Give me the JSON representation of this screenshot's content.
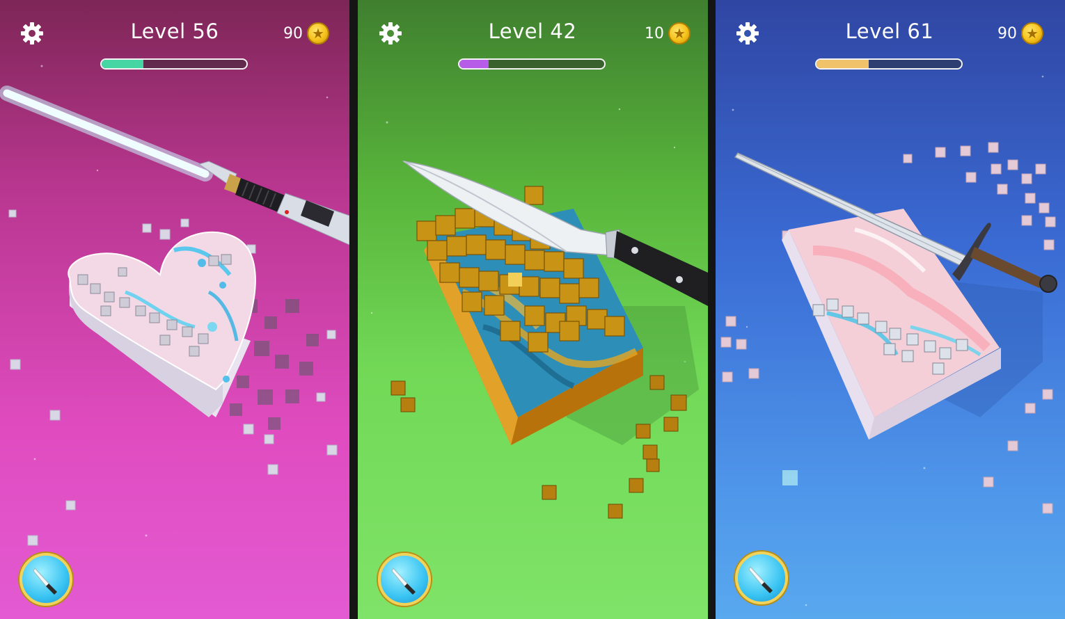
{
  "panels": [
    {
      "level": "Level 56",
      "coins": "90",
      "progress": 0.29,
      "progress_color": "#45d6a3",
      "weapon": "lightsaber",
      "block_shape": "heart"
    },
    {
      "level": "Level 42",
      "coins": "10",
      "progress": 0.2,
      "progress_color": "#b65ce8",
      "weapon": "chef-knife",
      "block_shape": "slab"
    },
    {
      "level": "Level 61",
      "coins": "90",
      "progress": 0.36,
      "progress_color": "#f0c26a",
      "weapon": "sword",
      "block_shape": "slab"
    }
  ],
  "icons": {
    "settings": "gear-icon",
    "coin": "star-coin-icon",
    "weapon_select": "knife-icon"
  },
  "colors": {
    "panel1_bg": "#c23e9f",
    "panel2_bg": "#62c446",
    "panel3_bg": "#3f7ad8",
    "coin_gold": "#f6c21b"
  }
}
